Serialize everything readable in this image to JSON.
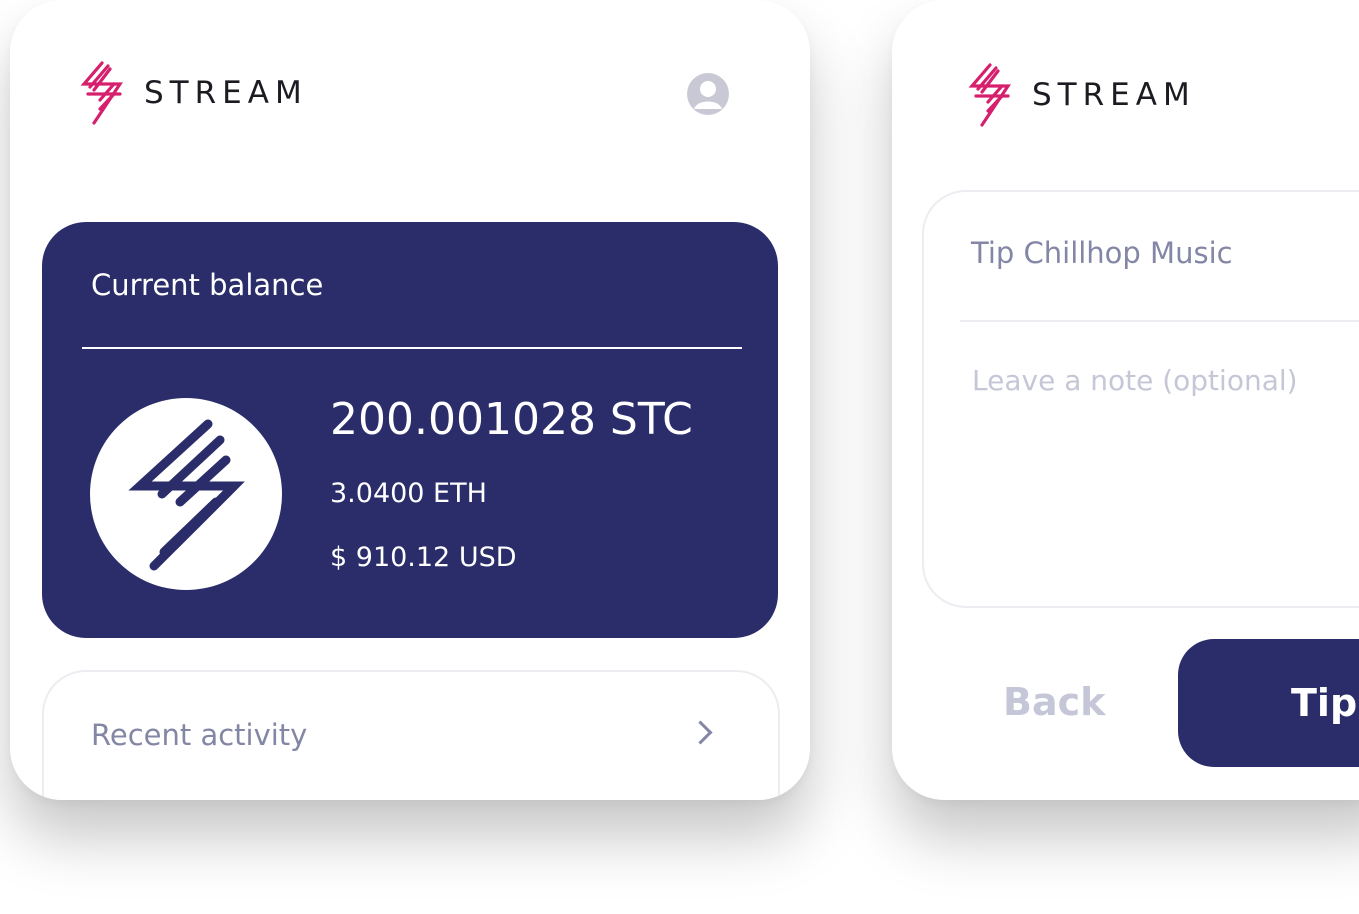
{
  "brand": {
    "name": "STREAM",
    "accent": "#d6206e",
    "primary": "#2a2d6a",
    "muted": "#8387a5"
  },
  "wallet": {
    "profile_icon": "user-circle-icon",
    "balance": {
      "title": "Current balance",
      "stc": "200.001028 STC",
      "eth": "3.0400 ETH",
      "usd": "$ 910.12 USD",
      "coin_icon": "stream-bolt-icon"
    },
    "recent_activity": {
      "label": "Recent activity",
      "icon": "chevron-right-icon"
    }
  },
  "tip": {
    "title": "Tip Chillhop Music",
    "note_placeholder": "Leave a note (optional)",
    "note_value": "",
    "back_label": "Back",
    "tip_label": "Tip"
  }
}
